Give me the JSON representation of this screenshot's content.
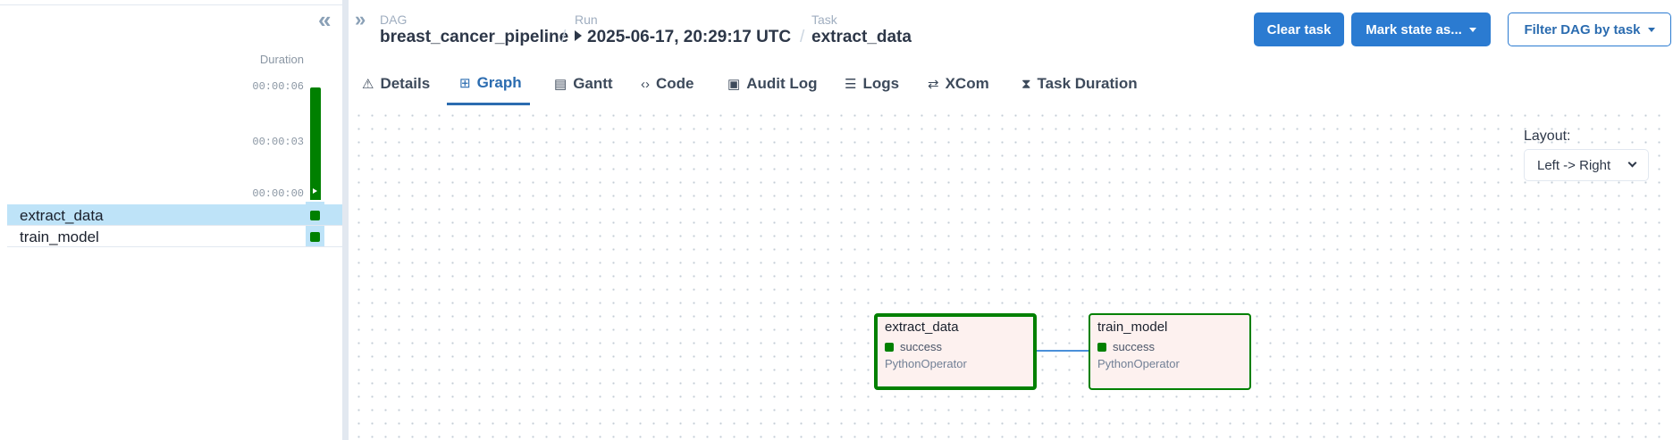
{
  "left_panel": {
    "duration_label": "Duration",
    "ticks": [
      "00:00:06",
      "00:00:03",
      "00:00:00"
    ],
    "tasks": [
      {
        "name": "extract_data",
        "state_color": "#008000",
        "selected": true
      },
      {
        "name": "train_model",
        "state_color": "#008000",
        "selected": false
      }
    ]
  },
  "breadcrumb": {
    "dag_label": "DAG",
    "dag_value": "breast_cancer_pipeline",
    "run_label": "Run",
    "run_value": "2025-06-17, 20:29:17 UTC",
    "task_label": "Task",
    "task_value": "extract_data"
  },
  "actions": {
    "clear_task": "Clear task",
    "mark_state": "Mark state as...",
    "filter_dag": "Filter DAG by task"
  },
  "tabs": [
    {
      "label": "Details",
      "icon": "warning-triangle-icon",
      "active": false
    },
    {
      "label": "Graph",
      "icon": "graph-icon",
      "active": true
    },
    {
      "label": "Gantt",
      "icon": "gantt-icon",
      "active": false
    },
    {
      "label": "Code",
      "icon": "code-icon",
      "active": false
    },
    {
      "label": "Audit Log",
      "icon": "file-log-icon",
      "active": false
    },
    {
      "label": "Logs",
      "icon": "list-lines-icon",
      "active": false
    },
    {
      "label": "XCom",
      "icon": "swap-arrows-icon",
      "active": false
    },
    {
      "label": "Task Duration",
      "icon": "hourglass-icon",
      "active": false
    }
  ],
  "graph": {
    "layout_label": "Layout:",
    "layout_value": "Left -> Right",
    "nodes": [
      {
        "name": "extract_data",
        "state": "success",
        "operator": "PythonOperator",
        "selected": true
      },
      {
        "name": "train_model",
        "state": "success",
        "operator": "PythonOperator",
        "selected": false
      }
    ]
  },
  "colors": {
    "success": "#008000",
    "primary": "#2b7bd1",
    "selected_row": "#bee3f8",
    "node_bg": "#fdf1ef",
    "edge": "#4a90d9"
  }
}
